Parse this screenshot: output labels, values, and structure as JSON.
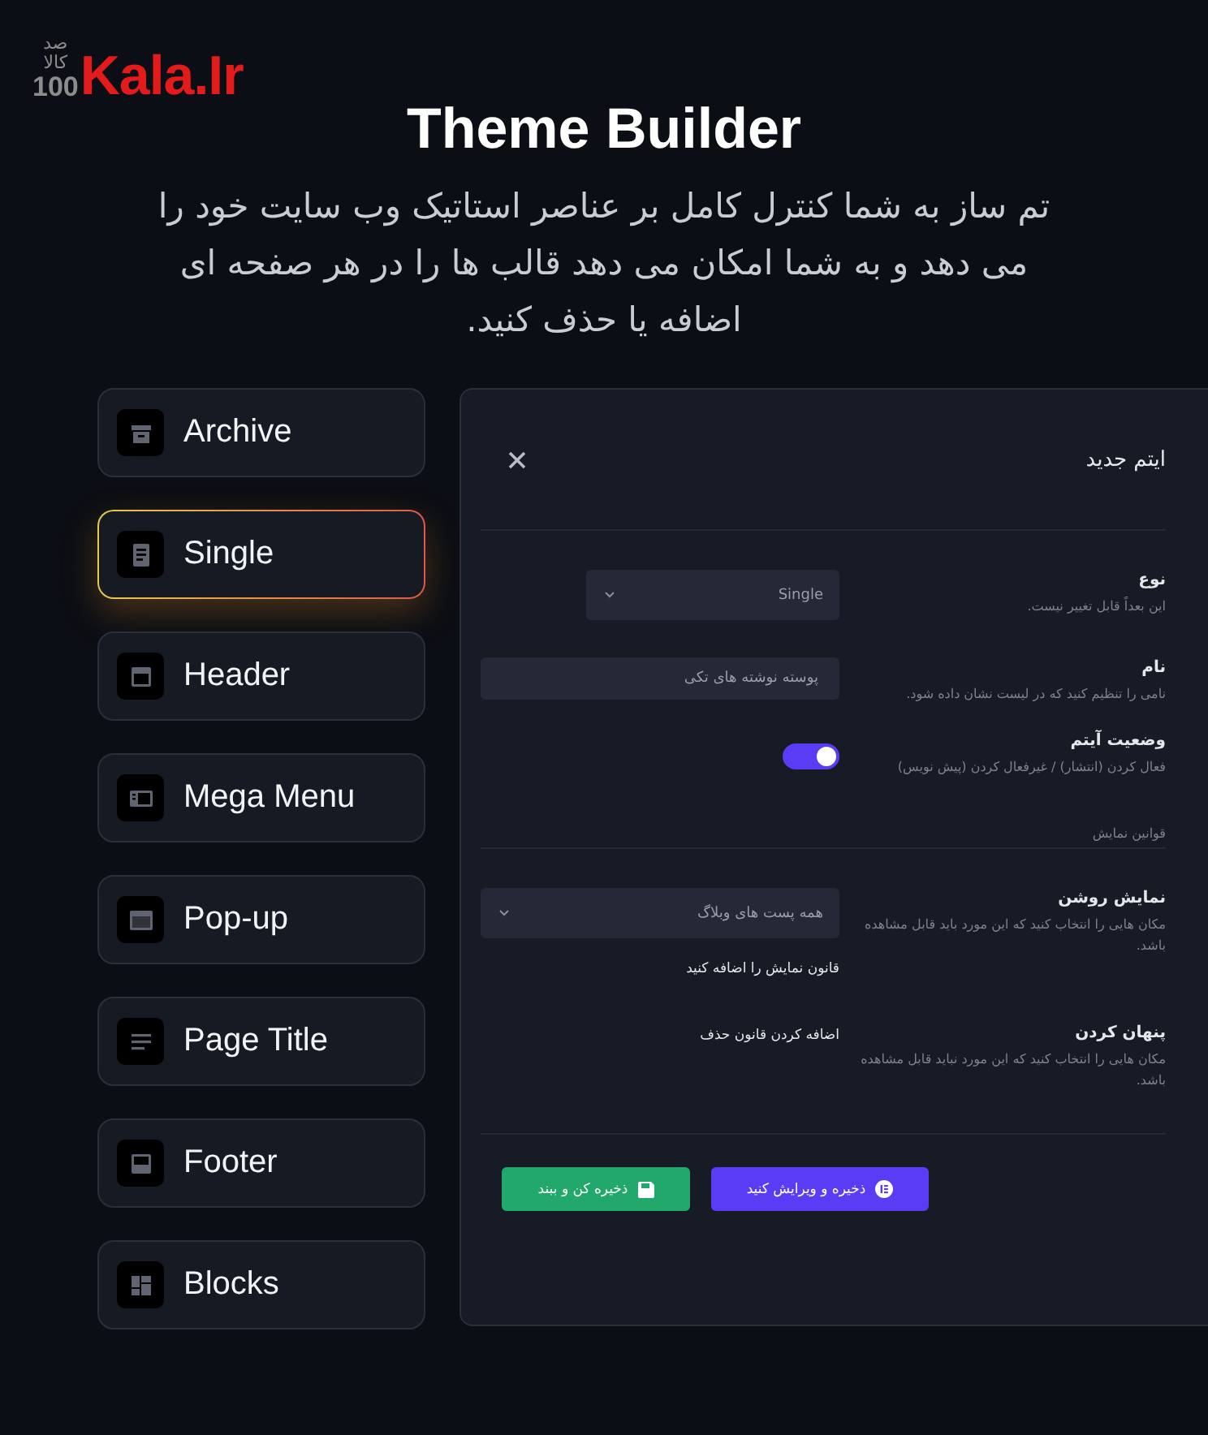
{
  "logo": {
    "persian_top": "صد",
    "persian_bottom": "کالا",
    "number": "100",
    "name": "Kala.Ir"
  },
  "title": "Theme Builder",
  "subtitle": "تم ساز به شما کنترل کامل بر عناصر استاتیک وب سایت خود را می دهد و به شما امکان می دهد قالب ها را در هر صفحه ای اضافه یا حذف کنید.",
  "templates": [
    {
      "label": "Archive",
      "selected": false
    },
    {
      "label": "Single",
      "selected": true
    },
    {
      "label": "Header",
      "selected": false
    },
    {
      "label": "Mega Menu",
      "selected": false
    },
    {
      "label": "Pop-up",
      "selected": false
    },
    {
      "label": "Page Title",
      "selected": false
    },
    {
      "label": "Footer",
      "selected": false
    },
    {
      "label": "Blocks",
      "selected": false
    }
  ],
  "dialog": {
    "title": "ایتم جدید",
    "fields": [
      {
        "kind": "select",
        "label": "نوع",
        "hint": "این بعداً قابل تغییر نیست.",
        "value": "Single"
      },
      {
        "kind": "text",
        "label": "نام",
        "hint": "نامی را تنظیم کنید که در لیست نشان داده شود.",
        "value": "پوسته نوشته های تکی"
      },
      {
        "kind": "toggle",
        "label": "وضعیت آیتم",
        "hint": "فعال کردن (انتشار) / غیرفعال کردن (پیش نویس)",
        "on": true
      },
      {
        "kind": "section",
        "label": "قوانین نمایش"
      },
      {
        "kind": "select",
        "label": "نمایش روشن",
        "hint": "مکان هایی را انتخاب کنید که این مورد باید قابل مشاهده باشد.",
        "value": "همه پست های وبلاگ",
        "link": "قانون نمایش را اضافه کنید"
      },
      {
        "kind": "link",
        "label": "پنهان کردن",
        "hint": "مکان هایی را انتخاب کنید که این مورد نباید قابل مشاهده باشد.",
        "link": "اضافه کردن قانون حذف"
      }
    ],
    "buttons": [
      {
        "kind": "save-edit",
        "label": "ذخیره و ویرایش کنید"
      },
      {
        "kind": "save-close",
        "label": "ذخیره کن و ببند"
      }
    ]
  }
}
